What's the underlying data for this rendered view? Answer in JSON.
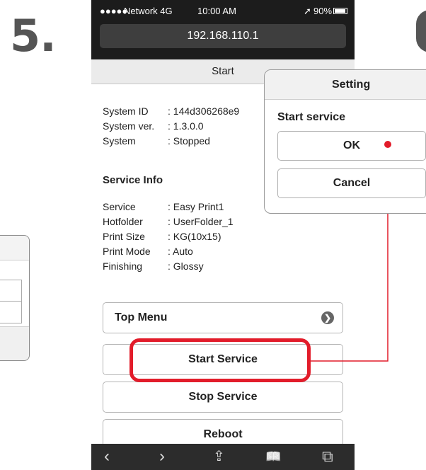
{
  "step": {
    "number": "5."
  },
  "status_bar": {
    "signal": "●●●●●",
    "carrier": "Network  4G",
    "time": "10:00 AM",
    "location_glyph": "➚",
    "battery": "90%"
  },
  "address_bar": {
    "url": "192.168.110.1"
  },
  "page": {
    "title": "Start"
  },
  "system": {
    "rows": [
      {
        "label": "System ID",
        "value": ": 144d306268e9"
      },
      {
        "label": "System ver.",
        "value": ": 1.3.0.0"
      },
      {
        "label": "System",
        "value": ": Stopped"
      }
    ]
  },
  "service_info": {
    "heading": "Service Info",
    "rows": [
      {
        "label": "Service",
        "value": ": Easy Print1"
      },
      {
        "label": "Hotfolder",
        "value": ": UserFolder_1"
      },
      {
        "label": "Print Size",
        "value": ": KG(10x15)"
      },
      {
        "label": "Print Mode",
        "value": ": Auto"
      },
      {
        "label": "Finishing",
        "value": ": Glossy"
      }
    ]
  },
  "buttons": {
    "top_menu": "Top Menu",
    "top_menu_chevron": "❯",
    "start_service": "Start Service",
    "stop_service": "Stop Service",
    "reboot": "Reboot"
  },
  "toolbar": {
    "back": "‹",
    "forward": "›",
    "share": "⇪",
    "bookmarks": "📖",
    "tabs": "⧉"
  },
  "dialog": {
    "title": "Setting",
    "message": "Start service",
    "ok": "OK",
    "cancel": "Cancel"
  },
  "colors": {
    "highlight": "#e21c2a",
    "status_bar": "#1c1c1c",
    "toolbar": "#2c2c2c"
  }
}
